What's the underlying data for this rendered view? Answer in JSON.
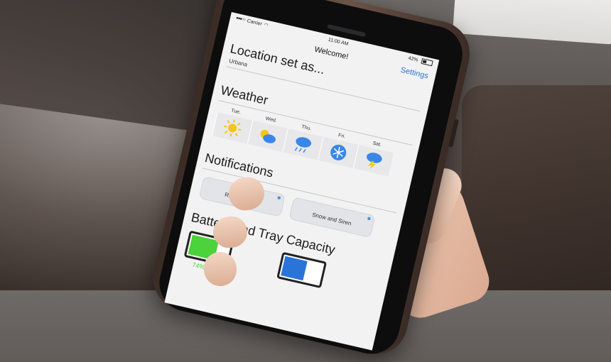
{
  "status_bar": {
    "carrier": "Carrier",
    "time": "11:00 AM",
    "battery_text": "42%"
  },
  "nav": {
    "title": "Welcome!",
    "settings_label": "Settings"
  },
  "location": {
    "heading": "Location set as...",
    "value": "Urbana"
  },
  "weather": {
    "heading": "Weather",
    "days": [
      {
        "label": "Tue.",
        "icon": "sun-icon"
      },
      {
        "label": "Wed.",
        "icon": "partly-cloudy-icon"
      },
      {
        "label": "Thu.",
        "icon": "rain-cloud-icon"
      },
      {
        "label": "Fri.",
        "icon": "snowflake-icon"
      },
      {
        "label": "Sat.",
        "icon": "thunderstorm-icon"
      }
    ]
  },
  "notifications": {
    "heading": "Notifications",
    "items": [
      {
        "text": "Rain and Dog"
      },
      {
        "text": "Snow and Siren"
      }
    ]
  },
  "capacity": {
    "heading": "Battery and Tray Capacity",
    "battery_percent": "74%",
    "battery_level": 0.74,
    "tray_level": 0.62
  },
  "colors": {
    "accent": "#2a74d9",
    "battery_green": "#4cd23a",
    "weather_blue": "#3a86e8",
    "sun_yellow": "#f5c518"
  }
}
